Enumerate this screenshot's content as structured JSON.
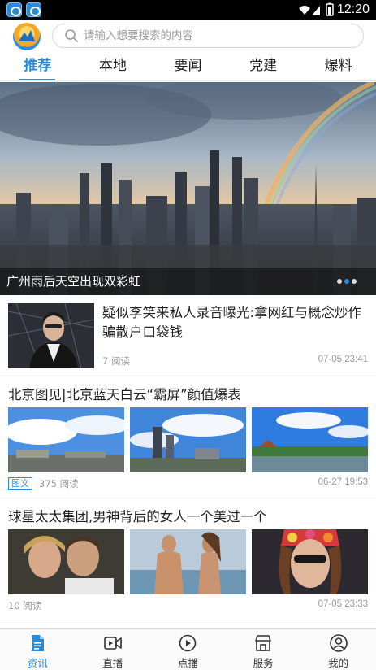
{
  "status_bar": {
    "time": "12:20"
  },
  "search": {
    "placeholder": "请输入想要搜索的内容"
  },
  "tabs": [
    {
      "label": "推荐",
      "active": true
    },
    {
      "label": "本地",
      "active": false
    },
    {
      "label": "要闻",
      "active": false
    },
    {
      "label": "党建",
      "active": false
    },
    {
      "label": "爆料",
      "active": false
    }
  ],
  "banner": {
    "caption": "广州雨后天空出现双彩虹",
    "slides": 3,
    "active_slide": 2
  },
  "feed": [
    {
      "title": "疑似李笑来私人录音曝光:拿网红与概念炒作骗散户口袋钱",
      "reads": "7 阅读",
      "time": "07-05 23:41"
    },
    {
      "title": "北京图见|北京蓝天白云“霸屏”颜值爆表",
      "tag": "图文",
      "reads": "375 阅读",
      "time": "06-27 19:53"
    },
    {
      "title": "球星太太集团,男神背后的女人一个美过一个",
      "reads": "10 阅读",
      "time": "07-05 23:33"
    }
  ],
  "bottom_nav": [
    {
      "label": "资讯",
      "icon": "news-icon",
      "active": true
    },
    {
      "label": "直播",
      "icon": "live-video-icon",
      "active": false
    },
    {
      "label": "点播",
      "icon": "play-icon",
      "active": false
    },
    {
      "label": "服务",
      "icon": "service-store-icon",
      "active": false
    },
    {
      "label": "我的",
      "icon": "user-icon",
      "active": false
    }
  ],
  "colors": {
    "accent": "#2a8ad8",
    "text": "#222222",
    "muted": "#999999"
  }
}
